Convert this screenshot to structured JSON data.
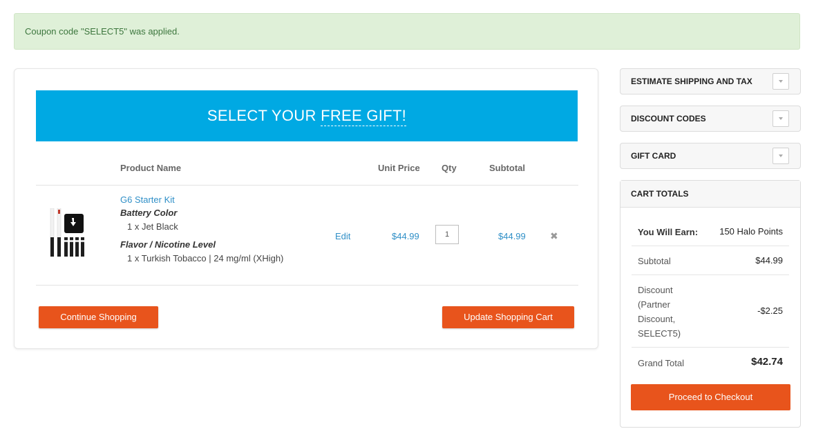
{
  "notice": {
    "message": "Coupon code \"SELECT5\" was applied."
  },
  "banner": {
    "text_plain": "SELECT YOUR ",
    "text_link": "FREE GIFT!"
  },
  "table": {
    "headers": {
      "product": "Product Name",
      "unit_price": "Unit Price",
      "qty": "Qty",
      "subtotal": "Subtotal"
    }
  },
  "item": {
    "name": "G6 Starter Kit",
    "options": [
      {
        "label": "Battery Color",
        "value": "1 x Jet Black"
      },
      {
        "label": "Flavor / Nicotine Level",
        "value": "1 x Turkish Tobacco | 24 mg/ml (XHigh)"
      }
    ],
    "edit_label": "Edit",
    "unit_price": "$44.99",
    "qty": "1",
    "subtotal": "$44.99",
    "remove_icon": "close-icon"
  },
  "actions": {
    "continue": "Continue Shopping",
    "update": "Update Shopping Cart"
  },
  "sidebar": {
    "panels": [
      {
        "title": "ESTIMATE SHIPPING AND TAX"
      },
      {
        "title": "DISCOUNT CODES"
      },
      {
        "title": "GIFT CARD"
      }
    ],
    "totals": {
      "title": "CART TOTALS",
      "earn_label": "You Will Earn:",
      "earn_value": "150 Halo Points",
      "subtotal_label": "Subtotal",
      "subtotal_value": "$44.99",
      "discount_label_lines": [
        "Discount",
        "(Partner",
        "Discount,",
        "SELECT5)"
      ],
      "discount_value": "-$2.25",
      "grand_total_label": "Grand Total",
      "grand_total_value": "$42.74",
      "checkout": "Proceed to Checkout"
    }
  },
  "colors": {
    "accent": "#e8541c",
    "banner": "#00a9e3",
    "link": "#2f8fc7",
    "notice_bg": "#dff0d8"
  }
}
